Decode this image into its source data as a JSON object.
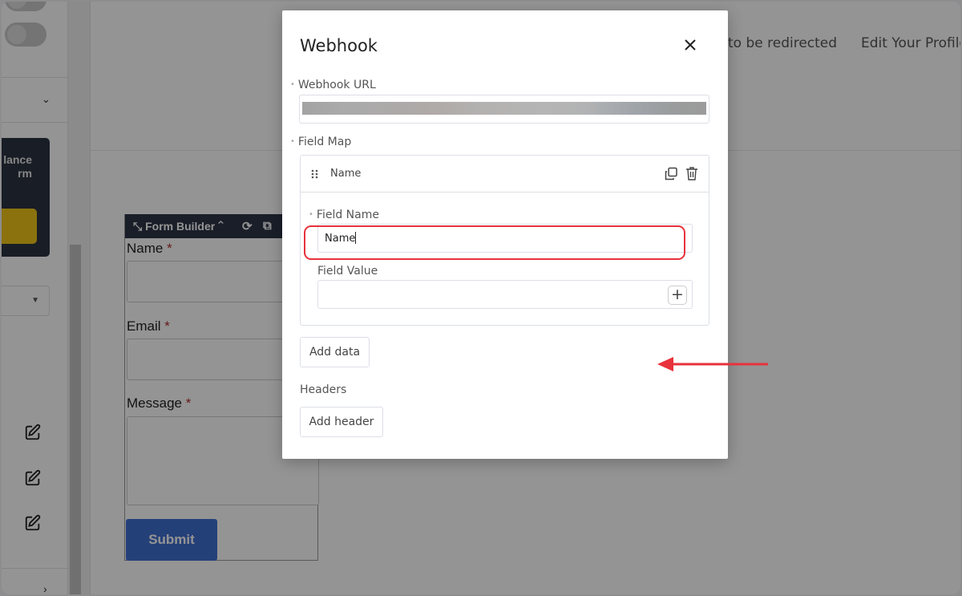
{
  "background": {
    "sidebar": {
      "promo_text": "lance\nrm",
      "icons": [
        "edit-icon",
        "edit-icon",
        "edit-icon"
      ]
    },
    "top_links": [
      "to be redirected",
      "Edit Your Profile"
    ],
    "form_builder": {
      "title": "Form Builder",
      "fields": [
        {
          "label": "Name",
          "required": "*"
        },
        {
          "label": "Email",
          "required": "*"
        },
        {
          "label": "Message",
          "required": "*"
        }
      ],
      "submit_label": "Submit"
    }
  },
  "modal": {
    "title": "Webhook",
    "webhook_url": {
      "label": "Webhook URL",
      "value_redacted": true
    },
    "field_map": {
      "label": "Field Map",
      "items": [
        {
          "name": "Name",
          "field_name_label": "Field Name",
          "field_name_value": "Name",
          "field_value_label": "Field Value",
          "field_value": ""
        }
      ]
    },
    "add_data_label": "Add data",
    "headers_label": "Headers",
    "add_header_label": "Add header"
  },
  "annotations": {
    "highlight_color": "#e8323c",
    "arrow_target": "Add data"
  }
}
